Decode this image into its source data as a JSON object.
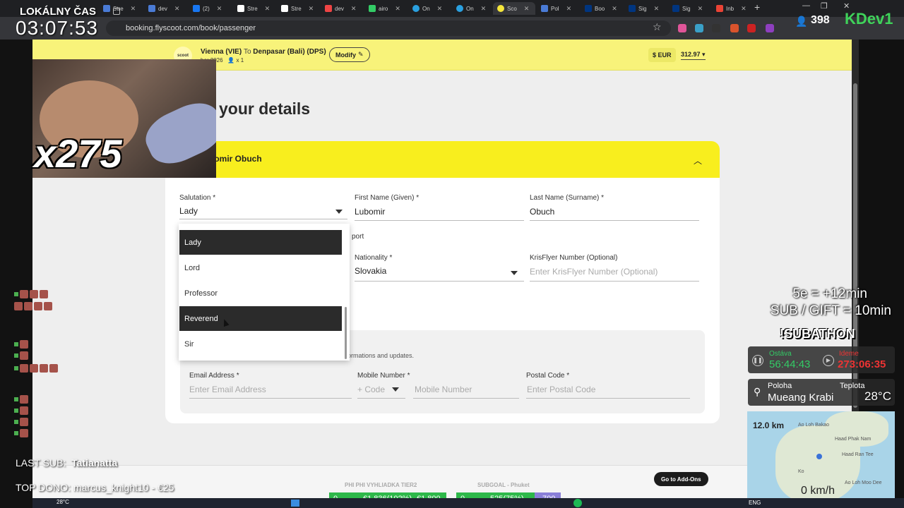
{
  "browser": {
    "tabs": [
      {
        "label": "Stre"
      },
      {
        "label": "dev"
      },
      {
        "label": "(2)"
      },
      {
        "label": "Stre"
      },
      {
        "label": "Stre"
      },
      {
        "label": "dev"
      },
      {
        "label": "airo"
      },
      {
        "label": "On"
      },
      {
        "label": "On"
      },
      {
        "label": "Sco"
      },
      {
        "label": "Pol"
      },
      {
        "label": "Boo"
      },
      {
        "label": "Sig"
      },
      {
        "label": "Sig"
      },
      {
        "label": "Inb"
      }
    ],
    "url": "booking.flyscoot.com/book/passenger"
  },
  "header": {
    "logo_text": "scoot",
    "origin": "Vienna (VIE)",
    "to_word": "To",
    "destination": "Denpasar (Bali) (DPS)",
    "date_fragment": "ber 2026",
    "pax_count": "x 1",
    "modify_label": "Modify",
    "currency": "$ EUR",
    "price": "312.97"
  },
  "main": {
    "title_fragment": "your details",
    "passenger_name": "bomir Obuch",
    "salutation_label": "Salutation *",
    "salutation_value": "Lady",
    "first_name_label": "First Name (Given) *",
    "first_name_value": "Lubomir",
    "last_name_label": "Last Name (Surname) *",
    "last_name_value": "Obuch",
    "passport_fragment": "port",
    "nationality_label": "Nationality *",
    "nationality_value": "Slovakia",
    "krisflyer_label": "KrisFlyer Number (Optional)",
    "krisflyer_placeholder": "Enter KrisFlyer Number (Optional)",
    "contact_text_fragment": "ormations and updates.",
    "email_label": "Email Address *",
    "email_placeholder": "Enter Email Address",
    "mobile_label": "Mobile Number *",
    "code_placeholder": "+ Code",
    "mobile_placeholder": "Mobile Number",
    "postal_label": "Postal Code *",
    "postal_placeholder": "Enter Postal Code",
    "addons_button": "Go to Add-Ons"
  },
  "dropdown": {
    "options": [
      {
        "label": "Lady",
        "selected": true
      },
      {
        "label": "Lord",
        "selected": false
      },
      {
        "label": "Professor",
        "selected": false
      },
      {
        "label": "Reverend",
        "selected": true
      },
      {
        "label": "Sir",
        "selected": false
      }
    ]
  },
  "overlay": {
    "clock_label": "LOKÁLNY ČAS",
    "clock_time": "03:07:53",
    "multiplier": "x275",
    "viewers": "398",
    "brand": "KDev1",
    "rule1": "5e = +12min",
    "rule2": "SUB / GIFT = 10min",
    "subathon": "!SUBATHON",
    "remaining_label": "Ostáva",
    "remaining_time": "56:44:43",
    "elapsed_label": "Ideme",
    "elapsed_time": "273:06:35",
    "location_label": "Poloha",
    "location_value": "Mueang Krabi",
    "temp_label": "Teplota",
    "temp_value": "28°C",
    "map_distance": "12.0 km",
    "map_speed": "0 km/h",
    "map_places": [
      "Ao Loh Bakao",
      "Haad Phak Nam",
      "Haad Ran Tee",
      "Ko",
      "Ao Loh Moo Dee"
    ],
    "last_sub_label": "LAST SUB:",
    "last_sub_name": "Tatianatta",
    "top_dono_label": "TOP DONO:",
    "top_dono_value": "marcus_knight10 - €25",
    "goal1_label": "PHI PHI VYHLIADKA TIER2",
    "goal1_start": "0",
    "goal1_progress": "€1,836(102%)",
    "goal1_target": "€1,800",
    "goal2_label": "SUBGOAL - Phuket",
    "goal2_start": "0",
    "goal2_progress": "525(75%)",
    "goal2_target": "700",
    "weather_temp": "28°C",
    "lang": "ENG"
  }
}
